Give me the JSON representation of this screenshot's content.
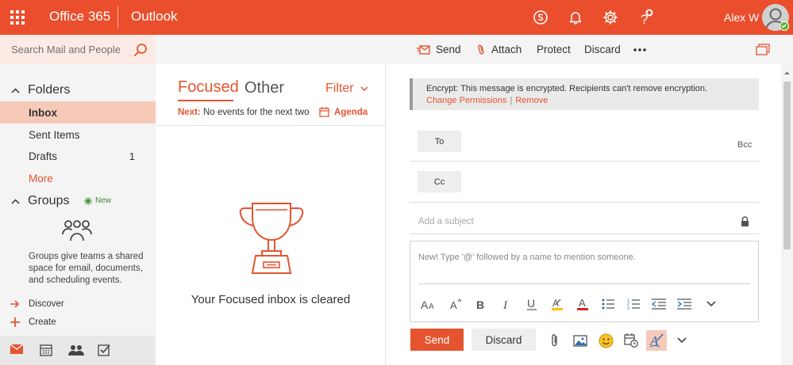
{
  "brand": "Office 365",
  "app_name": "Outlook",
  "user": {
    "name": "Alex W",
    "status": "available"
  },
  "header_icons": [
    "skype-icon",
    "bell-icon",
    "gear-icon",
    "help-icon"
  ],
  "search": {
    "placeholder": "Search Mail and People"
  },
  "toolbar": {
    "send": "Send",
    "attach": "Attach",
    "protect": "Protect",
    "discard": "Discard"
  },
  "folders": {
    "title": "Folders",
    "items": [
      {
        "label": "Inbox",
        "count": "",
        "selected": true
      },
      {
        "label": "Sent Items",
        "count": ""
      },
      {
        "label": "Drafts",
        "count": "1"
      }
    ],
    "more": "More"
  },
  "groups": {
    "title": "Groups",
    "new_badge": "New",
    "description": "Groups give teams a shared space for email, documents, and scheduling events.",
    "discover": "Discover",
    "create": "Create"
  },
  "bottom_nav": [
    "mail-icon",
    "calendar-icon",
    "people-icon",
    "tasks-icon"
  ],
  "message_list": {
    "tabs": {
      "focused": "Focused",
      "other": "Other"
    },
    "filter": "Filter",
    "next_label": "Next:",
    "next_text": "No events for the next two",
    "agenda": "Agenda",
    "empty_message": "Your Focused inbox is cleared"
  },
  "compose": {
    "encrypt_text": "Encrypt: This message is encrypted. Recipients can't remove encryption.",
    "change_permissions": "Change Permissions",
    "separator": "|",
    "remove": "Remove",
    "to": "To",
    "cc": "Cc",
    "bcc": "Bcc",
    "subject_placeholder": "Add a subject",
    "body_placeholder": "New! Type '@' followed by a name to mention someone.",
    "send": "Send",
    "discard": "Discard"
  },
  "colors": {
    "accent": "#ea4e2c",
    "selected": "#f6c9b9"
  }
}
